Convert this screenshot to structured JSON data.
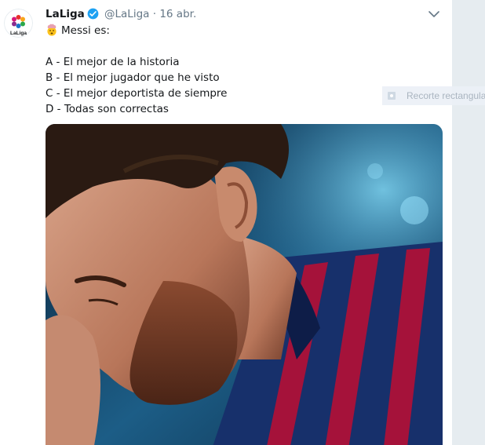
{
  "tweet": {
    "display_name": "LaLiga",
    "handle": "@LaLiga",
    "separator": "·",
    "date": "16 abr.",
    "avatar_wordmark": "LaLiga",
    "text": {
      "intro": "Messi es:",
      "options": [
        "A - El mejor de la historia",
        "B - El mejor jugador que he visto",
        "C - El mejor deportista de siempre",
        "D - Todas son correctas"
      ]
    },
    "icons": {
      "verified": "verified-badge-icon",
      "emoji": "exploding-head-emoji-icon",
      "menu": "chevron-down-icon"
    },
    "colors": {
      "verified": "#1da1f2",
      "text": "#14171a",
      "secondary": "#657786"
    }
  },
  "overlay": {
    "capture_label": "Recorte rectangular",
    "icon": "screen-capture-icon"
  }
}
